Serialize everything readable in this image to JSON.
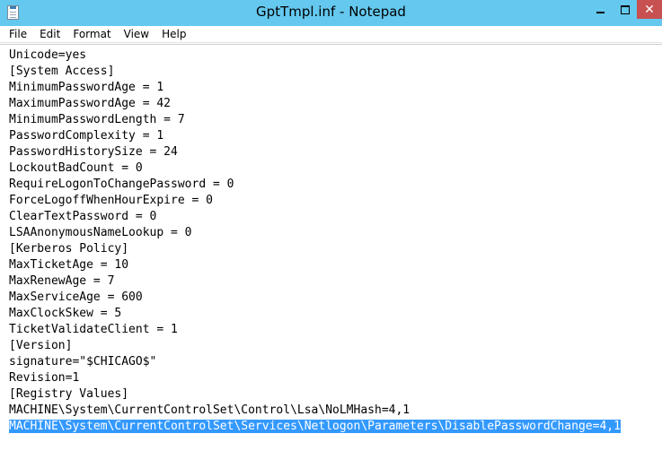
{
  "window": {
    "title": "GptTmpl.inf - Notepad",
    "close_glyph": "✕",
    "titlebar_color": "#64c8ef",
    "close_color": "#c75050",
    "icon": "notepad-icon"
  },
  "menu": {
    "items": [
      "File",
      "Edit",
      "Format",
      "View",
      "Help"
    ]
  },
  "editor": {
    "selection_color": "#3399ff",
    "selected_line_index": 23,
    "lines": [
      "Unicode=yes",
      "[System Access]",
      "MinimumPasswordAge = 1",
      "MaximumPasswordAge = 42",
      "MinimumPasswordLength = 7",
      "PasswordComplexity = 1",
      "PasswordHistorySize = 24",
      "LockoutBadCount = 0",
      "RequireLogonToChangePassword = 0",
      "ForceLogoffWhenHourExpire = 0",
      "ClearTextPassword = 0",
      "LSAAnonymousNameLookup = 0",
      "[Kerberos Policy]",
      "MaxTicketAge = 10",
      "MaxRenewAge = 7",
      "MaxServiceAge = 600",
      "MaxClockSkew = 5",
      "TicketValidateClient = 1",
      "[Version]",
      "signature=\"$CHICAGO$\"",
      "Revision=1",
      "[Registry Values]",
      "MACHINE\\System\\CurrentControlSet\\Control\\Lsa\\NoLMHash=4,1",
      "MACHINE\\System\\CurrentControlSet\\Services\\Netlogon\\Parameters\\DisablePasswordChange=4,1"
    ]
  }
}
